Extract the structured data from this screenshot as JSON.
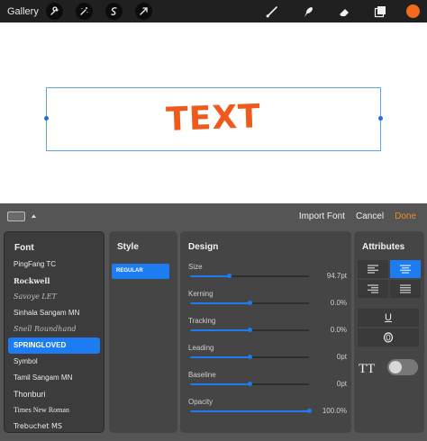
{
  "toolbar": {
    "gallery_label": "Gallery",
    "left_tools": [
      "wrench-icon",
      "magic-wand-icon",
      "selection-s-icon",
      "transform-arrow-icon"
    ],
    "right_tools": [
      "brush-icon",
      "smudge-icon",
      "eraser-icon",
      "layers-icon"
    ],
    "color_swatch": "#f26b1c"
  },
  "canvas": {
    "text": "TEXT",
    "text_color": "#ef5a1c",
    "selection_color": "#5aa5e8"
  },
  "panel": {
    "keyboard_icon": "keyboard-icon",
    "import_font": "Import Font",
    "cancel": "Cancel",
    "done": "Done",
    "font_title": "Font",
    "fonts": [
      {
        "label": "PingFang TC",
        "cls": ""
      },
      {
        "label": "Rockwell",
        "cls": "f-rock"
      },
      {
        "label": "Savoye LET",
        "cls": "f-script"
      },
      {
        "label": "Sinhala Sangam MN",
        "cls": ""
      },
      {
        "label": "Snell Roundhand",
        "cls": "f-script"
      },
      {
        "label": "SPRINGLOVED",
        "cls": "sel"
      },
      {
        "label": "Symbol",
        "cls": ""
      },
      {
        "label": "Tamil Sangam MN",
        "cls": ""
      },
      {
        "label": "Thonburi",
        "cls": "f-thon"
      },
      {
        "label": "Times New Roman",
        "cls": "f-times"
      },
      {
        "label": "Trebuchet MS",
        "cls": "f-trebu"
      }
    ],
    "style_title": "Style",
    "style_selected": "REGULAR",
    "design_title": "Design",
    "sliders": [
      {
        "label": "Size",
        "value": "94.7pt",
        "fraction": 0.33
      },
      {
        "label": "Kerning",
        "value": "0.0%",
        "fraction": 0.5
      },
      {
        "label": "Tracking",
        "value": "0.0%",
        "fraction": 0.5
      },
      {
        "label": "Leading",
        "value": "0pt",
        "fraction": 0.5
      },
      {
        "label": "Baseline",
        "value": "0pt",
        "fraction": 0.5
      },
      {
        "label": "Opacity",
        "value": "100.0%",
        "fraction": 1.0
      }
    ],
    "attributes_title": "Attributes",
    "align_buttons": [
      "align-left-icon",
      "align-center-icon",
      "align-right-icon",
      "align-justify-icon"
    ],
    "align_selected": "align-center-icon",
    "underline_glyph": "U",
    "outline_glyph": "O",
    "tt_label": "TT",
    "toggle_on": false,
    "accent": "#1d7cf2"
  }
}
